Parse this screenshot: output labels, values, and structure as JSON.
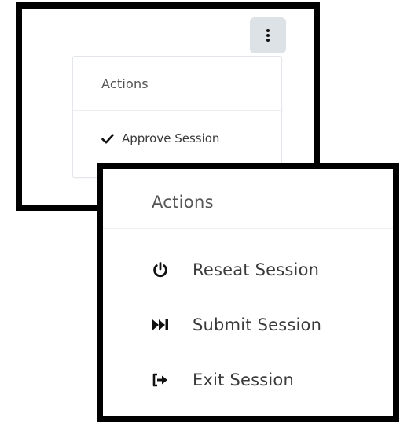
{
  "panel_a": {
    "kebab_icon": "ellipsis-vertical-icon",
    "menu": {
      "header": "Actions",
      "items": [
        {
          "icon": "check-icon",
          "label": "Approve Session"
        }
      ]
    }
  },
  "panel_b": {
    "menu": {
      "header": "Actions",
      "items": [
        {
          "icon": "power-icon",
          "label": "Reseat Session"
        },
        {
          "icon": "fast-forward-icon",
          "label": "Submit Session"
        },
        {
          "icon": "sign-out-icon",
          "label": "Exit Session"
        }
      ]
    }
  },
  "colors": {
    "kebab_bg": "#dde2e7",
    "text": "#3a3a3a",
    "frame": "#000000"
  }
}
